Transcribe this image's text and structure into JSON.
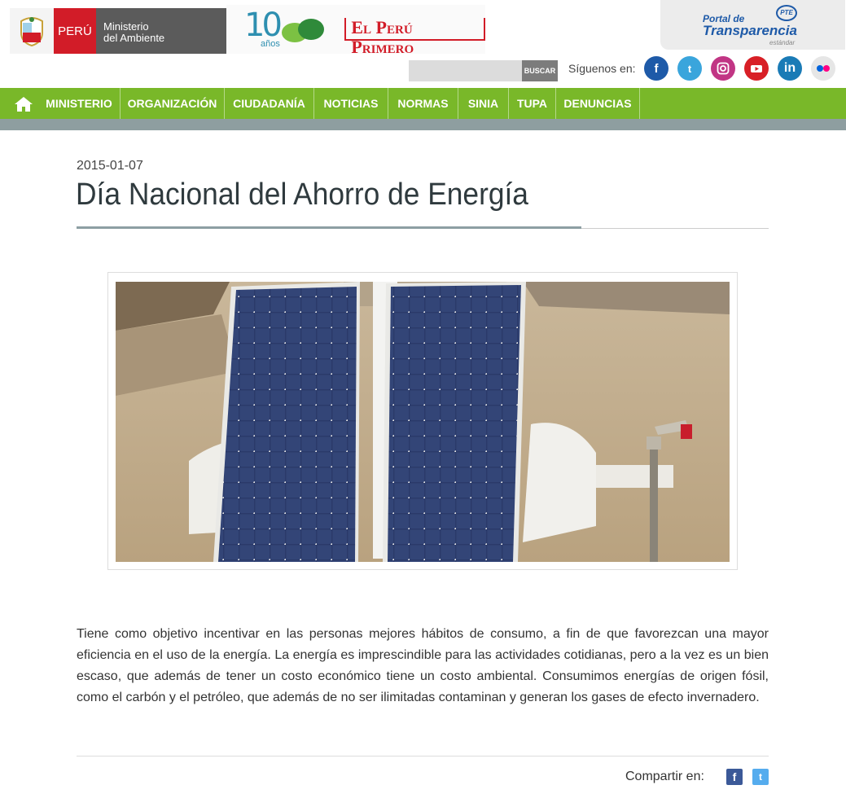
{
  "header": {
    "peru_label": "PERÚ",
    "ministry_line1": "Ministerio",
    "ministry_line2": "del Ambiente",
    "anniversary_number": "10",
    "anniversary_word": "años",
    "slogan": "El Perú Primero",
    "portal_line1": "Portal de",
    "portal_line2": "Transparencia",
    "portal_line3": "estándar",
    "portal_badge": "PTE"
  },
  "search": {
    "placeholder": "",
    "button_label": "BUSCAR"
  },
  "social": {
    "follow_label": "Síguenos en:",
    "icons": [
      "facebook-icon",
      "twitter-icon",
      "instagram-icon",
      "youtube-icon",
      "linkedin-icon",
      "flickr-icon"
    ]
  },
  "nav": {
    "items": [
      "MINISTERIO",
      "ORGANIZACIÓN",
      "CIUDADANÍA",
      "NOTICIAS",
      "NORMAS",
      "SINIA",
      "TUPA",
      "DENUNCIAS"
    ]
  },
  "article": {
    "date": "2015-01-07",
    "title": "Día Nacional del Ahorro de Energía",
    "body": "Tiene como objetivo incentivar en las personas mejores hábitos de consumo, a fin de que favorezcan una mayor eficiencia en el uso de la energía. La energía es imprescindible para las actividades cotidianas, pero a la vez es un bien escaso, que además de tener un costo económico tiene un costo ambiental. Consumimos energías de origen fósil, como el carbón y el petróleo, que además de no ser ilimitadas contaminan y generan los gases de efecto invernadero."
  },
  "share": {
    "label": "Compartir en:"
  },
  "colors": {
    "nav_green": "#79b829",
    "peru_red": "#d21c28",
    "ministry_gray": "#5b5b5b",
    "portal_blue": "#1e5aa8"
  }
}
